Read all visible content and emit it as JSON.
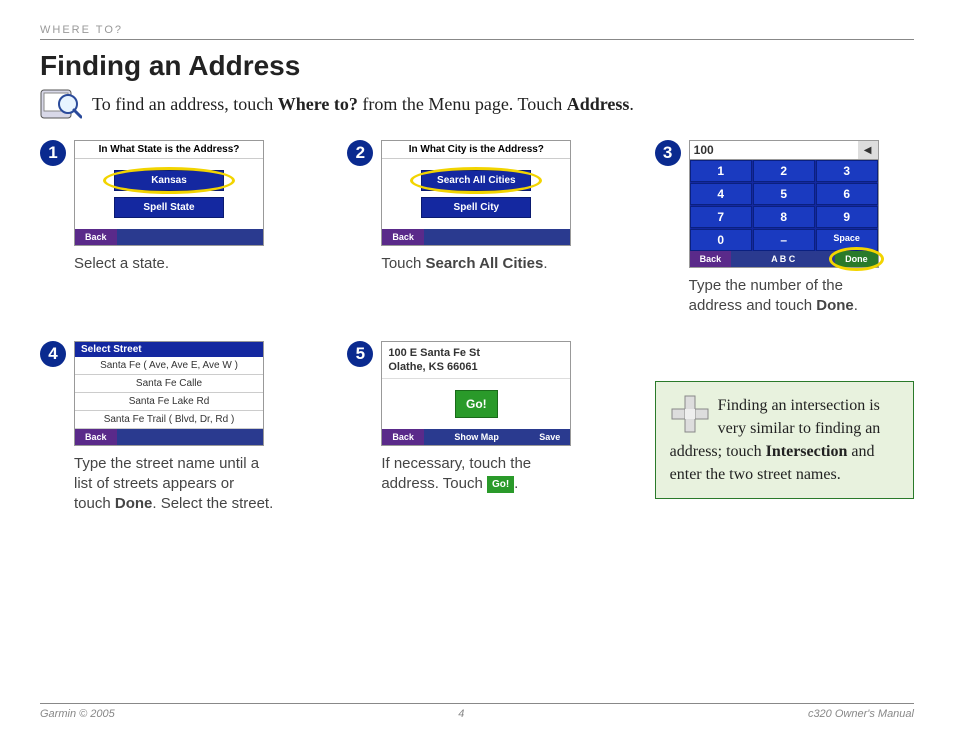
{
  "header_tag": "Where To?",
  "title": "Finding an Address",
  "intro": {
    "prefix": "To find an address, touch ",
    "bold1": "Where to?",
    "mid": " from the Menu page. Touch ",
    "bold2": "Address",
    "suffix": "."
  },
  "steps": {
    "s1": {
      "num": "1",
      "dev_title": "In What State is the Address?",
      "btn_highlight": "Kansas",
      "btn2": "Spell State",
      "back": "Back",
      "caption": "Select a state."
    },
    "s2": {
      "num": "2",
      "dev_title": "In What City is the Address?",
      "btn_highlight": "Search All Cities",
      "btn2": "Spell City",
      "back": "Back",
      "cap_a": "Touch ",
      "cap_b": "Search All Cities",
      "cap_c": "."
    },
    "s3": {
      "num": "3",
      "input_val": "100",
      "keys": [
        "1",
        "2",
        "3",
        "4",
        "5",
        "6",
        "7",
        "8",
        "9",
        "0",
        "–",
        "Space"
      ],
      "back": "Back",
      "mid": "A B C",
      "done": "Done",
      "cap_a": "Type the number of the address and touch ",
      "cap_b": "Done",
      "cap_c": "."
    },
    "s4": {
      "num": "4",
      "hdr": "Select Street",
      "rows": [
        "Santa Fe ( Ave, Ave E, Ave W )",
        "Santa Fe Calle",
        "Santa Fe Lake Rd",
        "Santa Fe Trail ( Blvd, Dr, Rd )"
      ],
      "back": "Back",
      "cap_a": "Type the street name until a list of streets appears or touch ",
      "cap_b": "Done",
      "cap_c": ". Select the street."
    },
    "s5": {
      "num": "5",
      "addr_l1": "100 E Santa Fe St",
      "addr_l2": "Olathe, KS 66061",
      "go": "Go!",
      "back": "Back",
      "showmap": "Show Map",
      "save": "Save",
      "cap_a": "If necessary, touch the address. Touch ",
      "go_inline": "Go!",
      "cap_b": "."
    }
  },
  "tip": {
    "t1": "Finding an intersection is very similar to finding an address; touch ",
    "b1": "Intersection",
    "t2": " and enter the two street names."
  },
  "footer": {
    "left": "Garmin © 2005",
    "center": "4",
    "right": "c320 Owner's Manual"
  }
}
